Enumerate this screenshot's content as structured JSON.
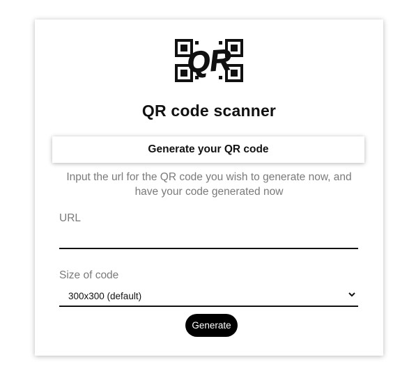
{
  "header": {
    "logo_text": "QR",
    "title": "QR code scanner"
  },
  "tab": {
    "label": "Generate your QR code"
  },
  "form": {
    "description": "Input the url for the QR code you wish to generate now, and have your code generated now",
    "url_label": "URL",
    "url_value": "",
    "size_label": "Size of code",
    "size_selected": "300x300 (default)",
    "generate_label": "Generate"
  },
  "icons": {
    "logo": "qr-logo-icon",
    "select_arrow": "chevron-down-icon"
  },
  "colors": {
    "text": "#111111",
    "muted": "#7a7a7a",
    "button_bg": "#000000",
    "button_text": "#ffffff"
  }
}
